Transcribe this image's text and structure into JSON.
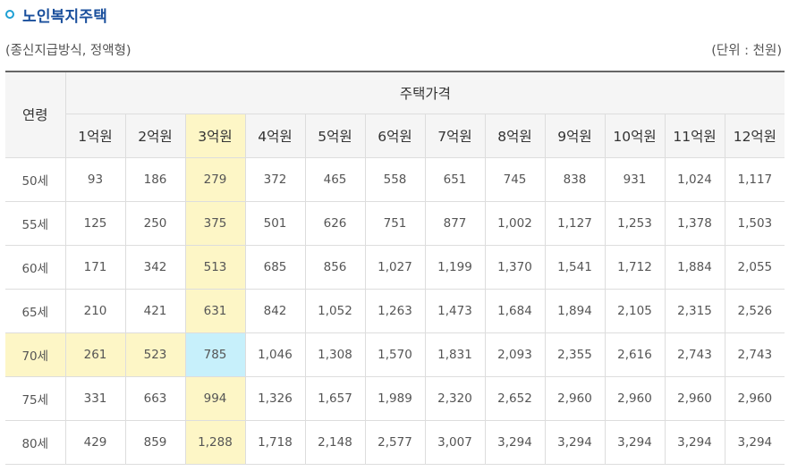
{
  "section_title": "노인복지주택",
  "subtitle": "(종신지급방식, 정액형)",
  "unit": "(단위 : 천원)",
  "table": {
    "age_header": "연령",
    "price_header": "주택가격",
    "price_columns": [
      "1억원",
      "2억원",
      "3억원",
      "4억원",
      "5억원",
      "6억원",
      "7억원",
      "8억원",
      "9억원",
      "10억원",
      "11억원",
      "12억원"
    ],
    "rows": [
      {
        "age": "50세",
        "values": [
          "93",
          "186",
          "279",
          "372",
          "465",
          "558",
          "651",
          "745",
          "838",
          "931",
          "1,024",
          "1,117"
        ]
      },
      {
        "age": "55세",
        "values": [
          "125",
          "250",
          "375",
          "501",
          "626",
          "751",
          "877",
          "1,002",
          "1,127",
          "1,253",
          "1,378",
          "1,503"
        ]
      },
      {
        "age": "60세",
        "values": [
          "171",
          "342",
          "513",
          "685",
          "856",
          "1,027",
          "1,199",
          "1,370",
          "1,541",
          "1,712",
          "1,884",
          "2,055"
        ]
      },
      {
        "age": "65세",
        "values": [
          "210",
          "421",
          "631",
          "842",
          "1,052",
          "1,263",
          "1,473",
          "1,684",
          "1,894",
          "2,105",
          "2,315",
          "2,526"
        ]
      },
      {
        "age": "70세",
        "values": [
          "261",
          "523",
          "785",
          "1,046",
          "1,308",
          "1,570",
          "1,831",
          "2,093",
          "2,355",
          "2,616",
          "2,743",
          "2,743"
        ]
      },
      {
        "age": "75세",
        "values": [
          "331",
          "663",
          "994",
          "1,326",
          "1,657",
          "1,989",
          "2,320",
          "2,652",
          "2,960",
          "2,960",
          "2,960",
          "2,960"
        ]
      },
      {
        "age": "80세",
        "values": [
          "429",
          "859",
          "1,288",
          "1,718",
          "2,148",
          "2,577",
          "3,007",
          "3,294",
          "3,294",
          "3,294",
          "3,294",
          "3,294"
        ]
      }
    ],
    "highlight": {
      "column": "3억원",
      "row": "70세",
      "column_color": "#fdf6c6",
      "cross_color": "#c7f0fb"
    }
  },
  "colors": {
    "title": "#1a4f9c",
    "bullet": "#1ea0d4",
    "header_bg": "#f5f5f5",
    "border": "#dddddd"
  }
}
